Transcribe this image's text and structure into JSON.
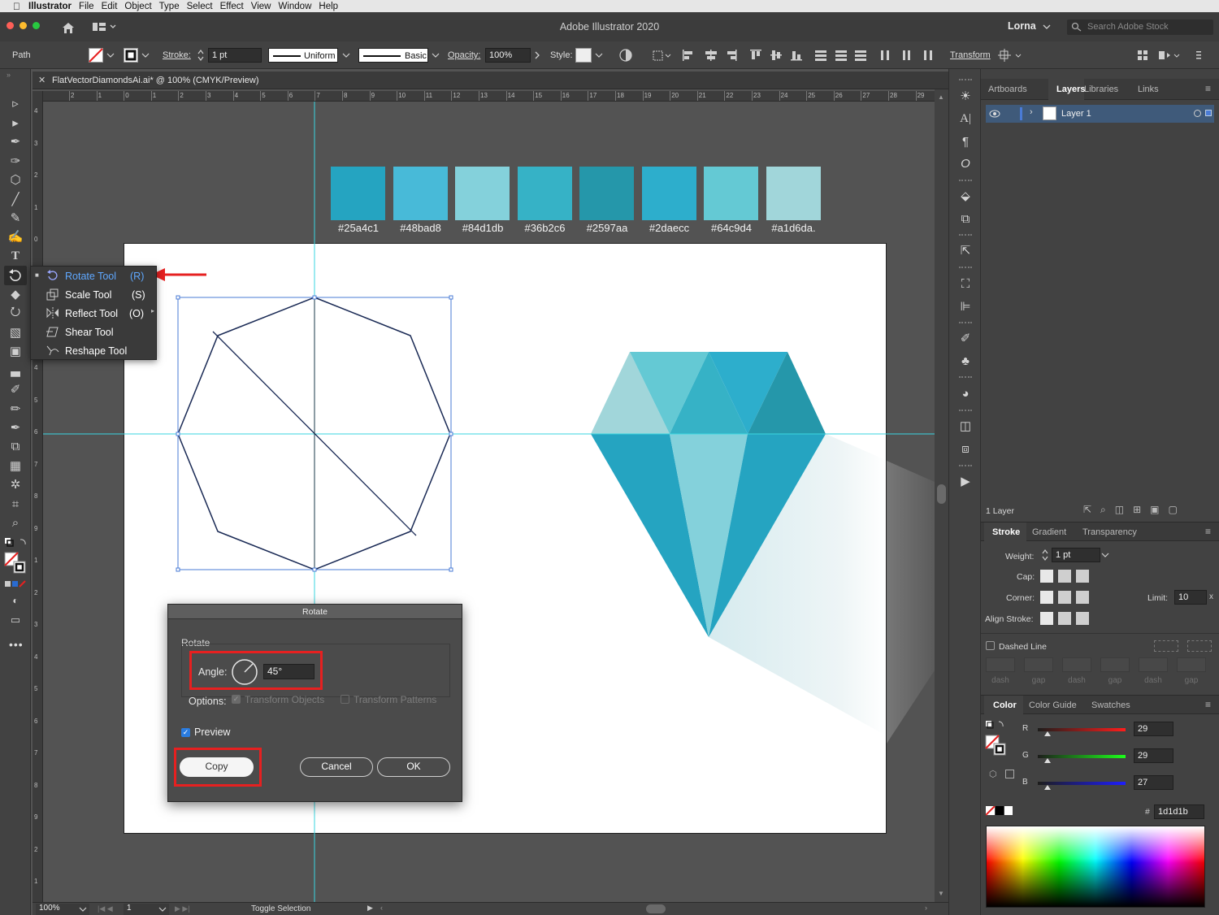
{
  "menubar": {
    "app_name": "Illustrator",
    "items": [
      "File",
      "Edit",
      "Object",
      "Type",
      "Select",
      "Effect",
      "View",
      "Window",
      "Help"
    ]
  },
  "titlebar": {
    "title": "Adobe Illustrator 2020",
    "user": "Lorna",
    "search_placeholder": "Search Adobe Stock"
  },
  "control": {
    "selection_type": "Path",
    "stroke_label": "Stroke:",
    "stroke_weight": "1 pt",
    "profile": "Uniform",
    "brush": "Basic",
    "opacity_label": "Opacity:",
    "opacity": "100%",
    "style_label": "Style:",
    "transform_label": "Transform"
  },
  "document": {
    "tab_title": "FlatVectorDiamondsAi.ai* @ 100% (CMYK/Preview)"
  },
  "ruler_top": [
    "2",
    "1",
    "0",
    "1",
    "2",
    "3",
    "4",
    "5",
    "6",
    "7",
    "8",
    "9",
    "10",
    "11",
    "12",
    "13",
    "14",
    "15",
    "16",
    "17",
    "18",
    "19",
    "20",
    "21",
    "22",
    "23",
    "24",
    "25",
    "26",
    "27",
    "28",
    "29"
  ],
  "ruler_left": [
    "4",
    "3",
    "2",
    "1",
    "0",
    "1",
    "2",
    "3",
    "4",
    "5",
    "6",
    "7",
    "8",
    "9",
    "1",
    "2",
    "3",
    "4",
    "5",
    "6",
    "7",
    "8",
    "9",
    "2",
    "1"
  ],
  "swatches": [
    {
      "hex": "#25a4c1",
      "label": "#25a4c1"
    },
    {
      "hex": "#48bad8",
      "label": "#48bad8"
    },
    {
      "hex": "#84d1db",
      "label": "#84d1db"
    },
    {
      "hex": "#36b2c6",
      "label": "#36b2c6"
    },
    {
      "hex": "#2597aa",
      "label": "#2597aa"
    },
    {
      "hex": "#2daecc",
      "label": "#2daecc"
    },
    {
      "hex": "#64c9d4",
      "label": "#64c9d4"
    },
    {
      "hex": "#a1d6da",
      "label": "#a1d6da."
    }
  ],
  "flyout": {
    "items": [
      {
        "label": "Rotate Tool",
        "shortcut": "(R)"
      },
      {
        "label": "Scale Tool",
        "shortcut": "(S)"
      },
      {
        "label": "Reflect Tool",
        "shortcut": "(O)"
      },
      {
        "label": "Shear Tool",
        "shortcut": ""
      },
      {
        "label": "Reshape Tool",
        "shortcut": ""
      }
    ]
  },
  "dialog": {
    "title": "Rotate",
    "group_label": "Rotate",
    "angle_label": "Angle:",
    "angle_value": "45°",
    "options_label": "Options:",
    "transform_objects": "Transform Objects",
    "transform_patterns": "Transform Patterns",
    "preview_label": "Preview",
    "copy_label": "Copy",
    "cancel_label": "Cancel",
    "ok_label": "OK"
  },
  "statusbar": {
    "zoom": "100%",
    "artboard": "1",
    "status": "Toggle Selection"
  },
  "layers_panel": {
    "tabs": [
      "Artboards",
      "Layers",
      "Libraries",
      "Links"
    ],
    "layer_name": "Layer 1",
    "layer_count": "1 Layer"
  },
  "stroke_panel": {
    "tabs": [
      "Stroke",
      "Gradient",
      "Transparency"
    ],
    "weight_label": "Weight:",
    "weight": "1 pt",
    "cap_label": "Cap:",
    "corner_label": "Corner:",
    "limit_label": "Limit:",
    "limit": "10",
    "align_label": "Align Stroke:",
    "dashed_label": "Dashed Line",
    "dash_labels": [
      "dash",
      "gap",
      "dash",
      "gap",
      "dash",
      "gap"
    ]
  },
  "color_panel": {
    "tabs": [
      "Color",
      "Color Guide",
      "Swatches"
    ],
    "r_label": "R",
    "r": "29",
    "g_label": "G",
    "g": "29",
    "b_label": "B",
    "b": "27",
    "hex_symbol": "#",
    "hex": "1d1d1b"
  },
  "colors": {
    "accent_red": "#e62020",
    "guide_cyan": "#3ad6e0",
    "selection_blue": "#4a7bd6"
  }
}
